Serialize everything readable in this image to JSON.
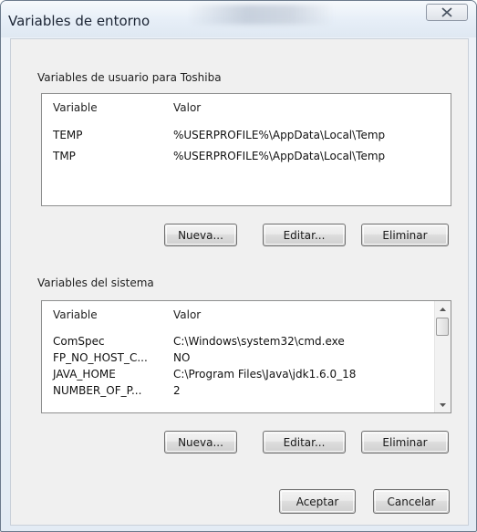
{
  "window": {
    "title": "Variables de entorno"
  },
  "user_vars": {
    "label": "Variables de usuario para Toshiba",
    "columns": [
      "Variable",
      "Valor"
    ],
    "rows": [
      {
        "name": "TEMP",
        "value": "%USERPROFILE%\\AppData\\Local\\Temp"
      },
      {
        "name": "TMP",
        "value": "%USERPROFILE%\\AppData\\Local\\Temp"
      }
    ],
    "buttons": {
      "new": "Nueva...",
      "edit": "Editar...",
      "delete": "Eliminar"
    }
  },
  "system_vars": {
    "label": "Variables del sistema",
    "columns": [
      "Variable",
      "Valor"
    ],
    "rows": [
      {
        "name": "ComSpec",
        "value": "C:\\Windows\\system32\\cmd.exe"
      },
      {
        "name": "FP_NO_HOST_C...",
        "value": "NO"
      },
      {
        "name": "JAVA_HOME",
        "value": "C:\\Program Files\\Java\\jdk1.6.0_18"
      },
      {
        "name": "NUMBER_OF_P...",
        "value": "2"
      }
    ],
    "buttons": {
      "new": "Nueva...",
      "edit": "Editar...",
      "delete": "Eliminar"
    }
  },
  "footer": {
    "ok": "Aceptar",
    "cancel": "Cancelar"
  },
  "icons": {
    "close": "close-icon",
    "scroll_up": "scroll-up-arrow-icon",
    "scroll_down": "scroll-down-arrow-icon"
  }
}
